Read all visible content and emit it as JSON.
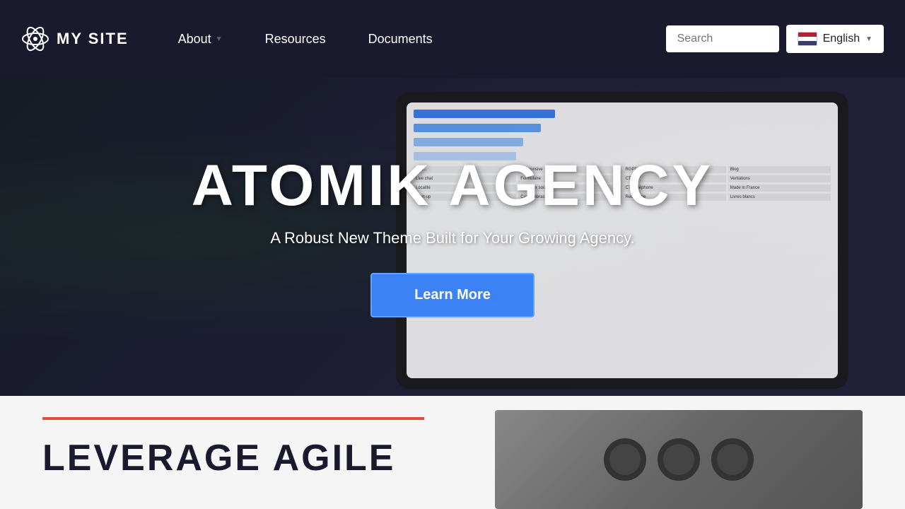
{
  "site": {
    "logo_text": "MY SITE",
    "logo_icon": "atom"
  },
  "navbar": {
    "links": [
      {
        "label": "About",
        "has_dropdown": true
      },
      {
        "label": "Resources",
        "has_dropdown": false
      },
      {
        "label": "Documents",
        "has_dropdown": false
      }
    ],
    "search_placeholder": "Search",
    "language": {
      "label": "English",
      "flag": "us"
    }
  },
  "hero": {
    "title": "ATOMIK AGENCY",
    "subtitle": "A Robust New Theme Built for Your Growing Agency.",
    "cta_label": "Learn More"
  },
  "below_hero": {
    "section_title": "LEVERAGE AGILE"
  }
}
